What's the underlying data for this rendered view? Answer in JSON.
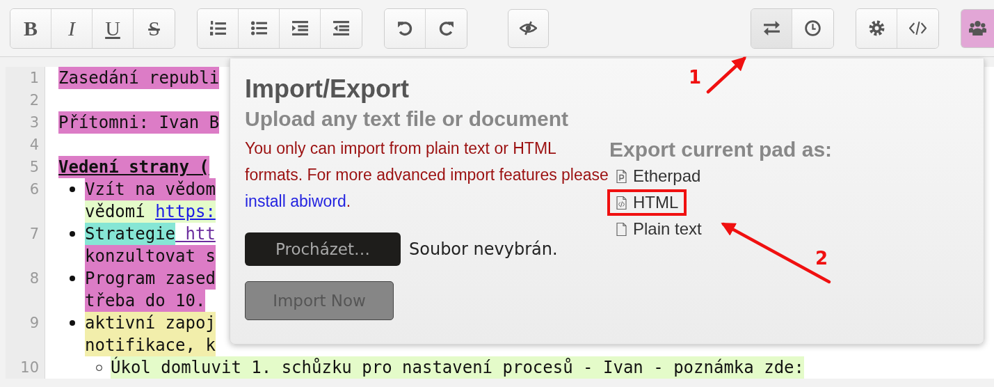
{
  "toolbar": {
    "left_groups": [
      {
        "buttons": [
          {
            "kind": "bold",
            "label": "B",
            "active": false
          },
          {
            "kind": "italic",
            "label": "I",
            "active": false
          },
          {
            "kind": "underline",
            "label": "U",
            "active": false
          },
          {
            "kind": "strike",
            "label": "S",
            "active": false
          }
        ]
      },
      {
        "buttons": [
          {
            "kind": "ordered-list",
            "active": false
          },
          {
            "kind": "bullet-list",
            "active": false
          },
          {
            "kind": "indent",
            "active": false
          },
          {
            "kind": "outdent",
            "active": false
          }
        ]
      },
      {
        "buttons": [
          {
            "kind": "undo",
            "active": false
          },
          {
            "kind": "redo",
            "active": false
          }
        ]
      },
      {
        "buttons": [
          {
            "kind": "eye-slash",
            "active": false
          }
        ]
      }
    ],
    "right_groups": [
      {
        "buttons": [
          {
            "kind": "import-export",
            "active": true
          },
          {
            "kind": "clock",
            "active": false
          }
        ]
      },
      {
        "buttons": [
          {
            "kind": "settings",
            "active": false
          },
          {
            "kind": "code",
            "active": false
          }
        ]
      },
      {
        "buttons": [
          {
            "kind": "users",
            "color": "#e2a6d6"
          }
        ]
      }
    ]
  },
  "editor": {
    "lines": [
      {
        "number": "1",
        "kind": "plain",
        "rows": [
          [
            {
              "text": "Zasedání republi",
              "kind": "text",
              "color": "#dc7cc6"
            }
          ]
        ]
      },
      {
        "number": "2",
        "kind": "plain"
      },
      {
        "number": "3",
        "kind": "plain",
        "rows": [
          [
            {
              "text": "Přítomni: Ivan B",
              "kind": "text",
              "color": "#dc7cc6"
            }
          ]
        ]
      },
      {
        "number": "4",
        "kind": "plain"
      },
      {
        "number": "5",
        "kind": "heading",
        "rows": [
          [
            {
              "text": "Vedení strany (",
              "kind": "text",
              "color": "#dc7cc6"
            }
          ]
        ]
      },
      {
        "number": "6",
        "kind": "bullet",
        "rows": [
          [
            {
              "text": "Vzít na vědom",
              "kind": "text",
              "color": "#dc7cc6"
            }
          ],
          [
            {
              "text": "vědomí ",
              "kind": "text",
              "color": "#e4fbc9"
            },
            {
              "text": "https:",
              "kind": "link",
              "color": "#e4fbc9"
            }
          ]
        ]
      },
      {
        "number": "7",
        "kind": "bullet",
        "rows": [
          [
            {
              "text": "Strategie",
              "kind": "text",
              "color": "#86e6d5"
            },
            {
              "text": " htt",
              "kind": "visited-link"
            }
          ],
          [
            {
              "text": "konzultovat s",
              "kind": "text",
              "color": "#dc7cc6"
            }
          ]
        ]
      },
      {
        "number": "8",
        "kind": "bullet",
        "rows": [
          [
            {
              "text": "Program zased",
              "kind": "text",
              "color": "#dc7cc6"
            }
          ],
          [
            {
              "text": "třeba do 10.",
              "kind": "text",
              "color": "#dc7cc6"
            }
          ]
        ]
      },
      {
        "number": "9",
        "kind": "bullet",
        "rows": [
          [
            {
              "text": "aktivní zapoj",
              "kind": "text",
              "color": "#f2eeab"
            }
          ],
          [
            {
              "text": "notifikace, k",
              "kind": "text",
              "color": "#f2eeab"
            }
          ]
        ]
      },
      {
        "number": "10",
        "kind": "sub-bullet",
        "rows": [
          [
            {
              "text": "Úkol domluvit 1. schůzku pro nastavení procesů - Ivan - poznámka zde:",
              "kind": "text",
              "color": "#e4fbc9"
            }
          ]
        ]
      }
    ]
  },
  "import_export": {
    "title": "Import/Export",
    "subtitle": "Upload any text file or document",
    "notice": "You only can import from plain text or HTML formats. For more advanced import features please ",
    "notice_link": "install abiword",
    "notice_end": ".",
    "browse_button": "Procházet…",
    "file_status": "Soubor nevybrán.",
    "import_button": {
      "label": "Import Now",
      "disabled": true
    },
    "export_heading": "Export current pad as:",
    "export_items": [
      {
        "label": "Etherpad",
        "kind": "etherpad",
        "highlighted": false
      },
      {
        "label": "HTML",
        "kind": "html",
        "highlighted": true
      },
      {
        "label": "Plain text",
        "kind": "text",
        "highlighted": false
      }
    ]
  },
  "annotations": [
    {
      "label": "1"
    },
    {
      "label": "2"
    }
  ]
}
